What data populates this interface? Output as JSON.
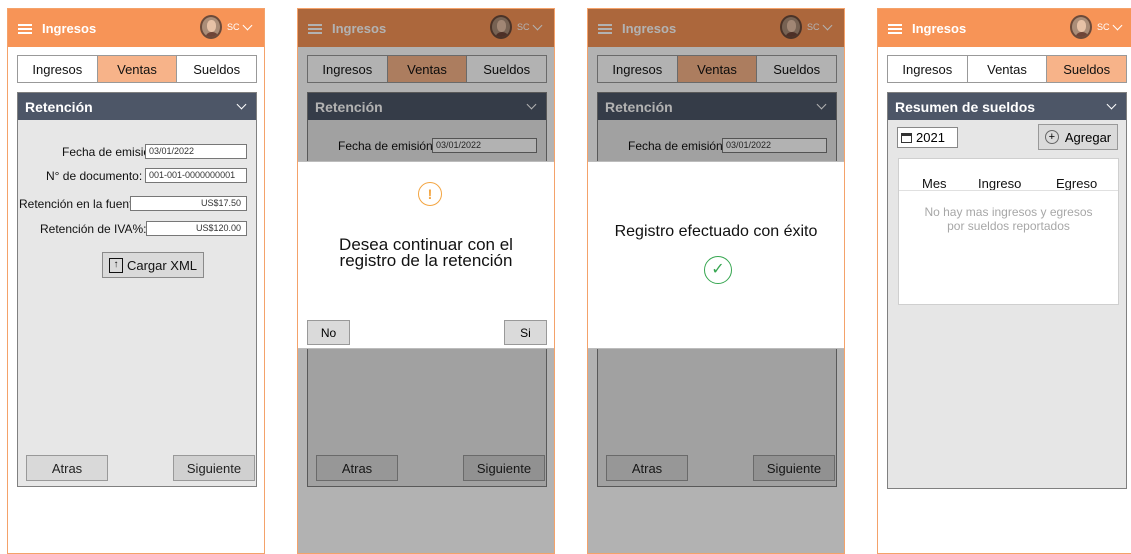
{
  "app_title": "Ingresos",
  "user_initials": "SC",
  "tabs": [
    "Ingresos",
    "Ventas",
    "Sueldos"
  ],
  "retention": {
    "header": "Retención",
    "labels": {
      "issue_date": "Fecha de emisión:",
      "doc_number": "N° de documento:",
      "source_retention": "Retención en la fuente:",
      "vat_retention": "Retención de IVA%:"
    },
    "values": {
      "issue_date": "03/01/2022",
      "doc_number": "001-001-0000000001",
      "source_retention": "US$17.50",
      "vat_retention": "US$120.00"
    },
    "upload_label": "Cargar XML",
    "back_label": "Atras",
    "next_label": "Siguiente"
  },
  "confirm_dialog": {
    "message_line1": "Desea continuar con el",
    "message_line2": "registro de la retención",
    "no_label": "No",
    "yes_label": "Si"
  },
  "success_dialog": {
    "message": "Registro efectuado con éxito"
  },
  "payroll": {
    "header": "Resumen de sueldos",
    "year": "2021",
    "add_label": "Agregar",
    "columns": [
      "Mes",
      "Ingreso",
      "Egreso"
    ],
    "empty_line1": "No hay mas ingresos y egresos",
    "empty_line2": "por sueldos reportados"
  },
  "colors": {
    "topbar": "#f79457",
    "active_tab": "#f7b389",
    "card_header": "#4d5667",
    "success": "#36a650",
    "warning": "#f3a542"
  },
  "icons": [
    "menu-icon",
    "avatar",
    "chevron-down-icon",
    "upload-icon",
    "warning-icon",
    "check-icon",
    "calendar-icon",
    "plus-icon"
  ]
}
